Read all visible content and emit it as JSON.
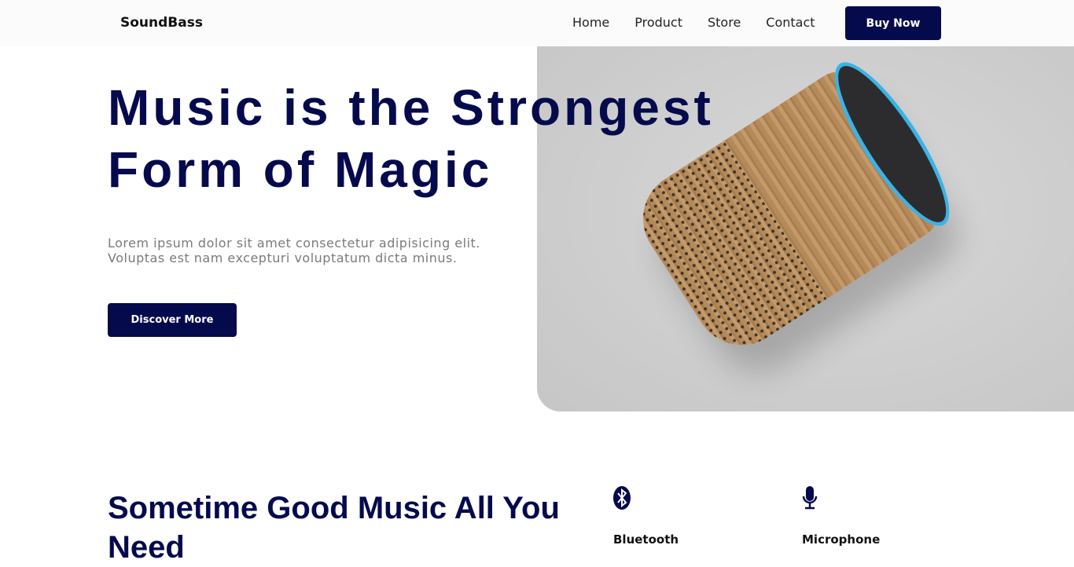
{
  "nav": {
    "logo": "SoundBass",
    "links": [
      "Home",
      "Product",
      "Store",
      "Contact"
    ],
    "buy": "Buy Now"
  },
  "hero": {
    "title_line1": "Music is the Strongest",
    "title_line2": "Form of Magic",
    "subtitle_line1": "Lorem ipsum dolor sit amet consectetur adipisicing elit.",
    "subtitle_line2": "Voluptas est nam excepturi voluptatum dicta minus.",
    "cta": "Discover More"
  },
  "section": {
    "title": "Sometime Good Music All You Need",
    "features": [
      {
        "icon": "bluetooth-icon",
        "label": "Bluetooth"
      },
      {
        "icon": "microphone-icon",
        "label": "Microphone"
      }
    ]
  },
  "colors": {
    "brand": "#050a4d"
  }
}
